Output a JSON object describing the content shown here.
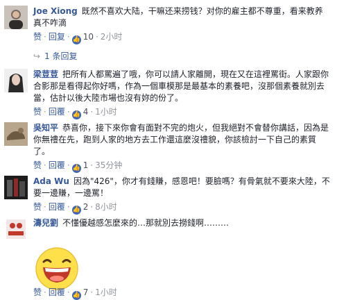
{
  "comments": [
    {
      "name": "Joe Xiong",
      "text": "既然不喜欢大陆，干嘛还来捞钱？对你的雇主都不尊重，看来教养真不咋滴",
      "reply": "回复",
      "likes": "10",
      "time": "2小时",
      "replies_label": "1 条回复",
      "like_label": "赞"
    },
    {
      "name": "梁荳荳",
      "text": "把所有人都罵遍了哦，你可以請人家離開，現在又在這裡罵街。人家跟你合影那是看得起你好嗎，作為一個車模那是最基本的素養吧，沒那個素養就別去當，估計以後大陸市場也沒有妳的份了。",
      "reply": "回覆",
      "likes": "4",
      "time": "1小时",
      "like_label": "赞"
    },
    {
      "name": "吳知平",
      "text": "恭喜你，接下來你會有面對不完的炮火，但我絕對不會替你講話，因為是你無禮在先，跑到人家的地方去工作還這麼沒禮貌，你該檢討一下自己的素質了。",
      "reply": "回覆",
      "likes": "1",
      "time": "35分钟",
      "like_label": "赞"
    },
    {
      "name": "Ada Wu",
      "text": "因為\"426\"，你才有錢賺，感恩吧！要臉嗎？有骨氣就不要來大陸，不要一邊賺，一邊罵！",
      "reply": "回覆",
      "likes": "2",
      "time": "8小时",
      "like_label": "赞"
    },
    {
      "name": "濤兒劉",
      "text": "不懂優越感怎麼來的…那就別去撈錢啊………",
      "reply": "回覆",
      "likes": "7",
      "time": "1小时",
      "like_label": "赞",
      "emoji": "laughing-face"
    }
  ],
  "icons": {
    "like": "thumbs-up-icon",
    "reply_arrow": "reply-arrow-icon"
  },
  "colors": {
    "name": "#365899",
    "meta": "#90949c",
    "like_badge": "#4267b2",
    "emoji_yellow": "#ffe04a"
  }
}
